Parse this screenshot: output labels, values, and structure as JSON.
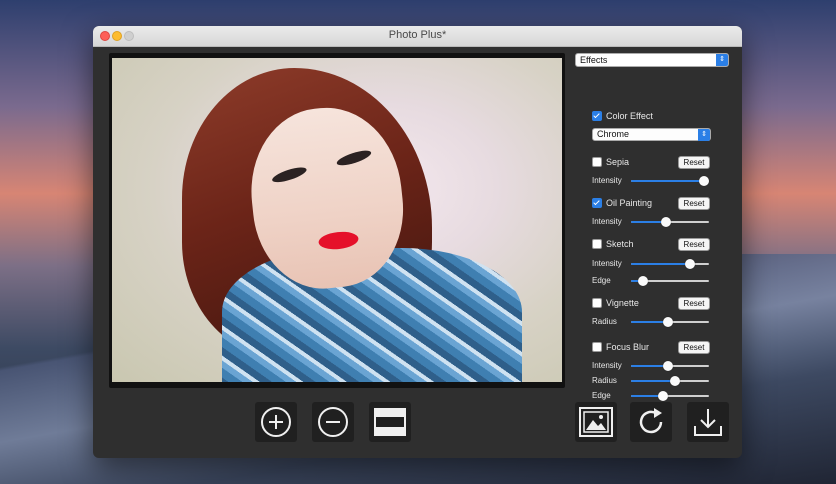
{
  "window": {
    "title": "Photo Plus*"
  },
  "panel": {
    "effects_select": "Effects",
    "color_effect": {
      "label": "Color Effect",
      "checked": true,
      "option": "Chrome"
    },
    "sepia": {
      "label": "Sepia",
      "checked": false,
      "reset": "Reset",
      "intensity_label": "Intensity",
      "intensity": 0.93
    },
    "oil_painting": {
      "label": "Oil Painting",
      "checked": true,
      "reset": "Reset",
      "intensity_label": "Intensity",
      "intensity": 0.45
    },
    "sketch": {
      "label": "Sketch",
      "checked": false,
      "reset": "Reset",
      "intensity_label": "Intensity",
      "intensity": 0.75,
      "edge_label": "Edge",
      "edge": 0.16
    },
    "vignette": {
      "label": "Vignette",
      "checked": false,
      "reset": "Reset",
      "radius_label": "Radius",
      "radius": 0.47
    },
    "focus_blur": {
      "label": "Focus Blur",
      "checked": false,
      "reset": "Reset",
      "intensity_label": "Intensity",
      "intensity": 0.47,
      "radius_label": "Radius",
      "radius": 0.57,
      "edge_label": "Edge",
      "edge": 0.41
    }
  },
  "toolbar": {
    "left": [
      "zoom-in-icon",
      "zoom-out-icon",
      "fit-icon"
    ],
    "right": [
      "image-icon",
      "rotate-icon",
      "download-icon"
    ]
  },
  "colors": {
    "accent": "#2b7fe6",
    "window_bg": "#2f2f2f",
    "lips": "#e5102a"
  }
}
